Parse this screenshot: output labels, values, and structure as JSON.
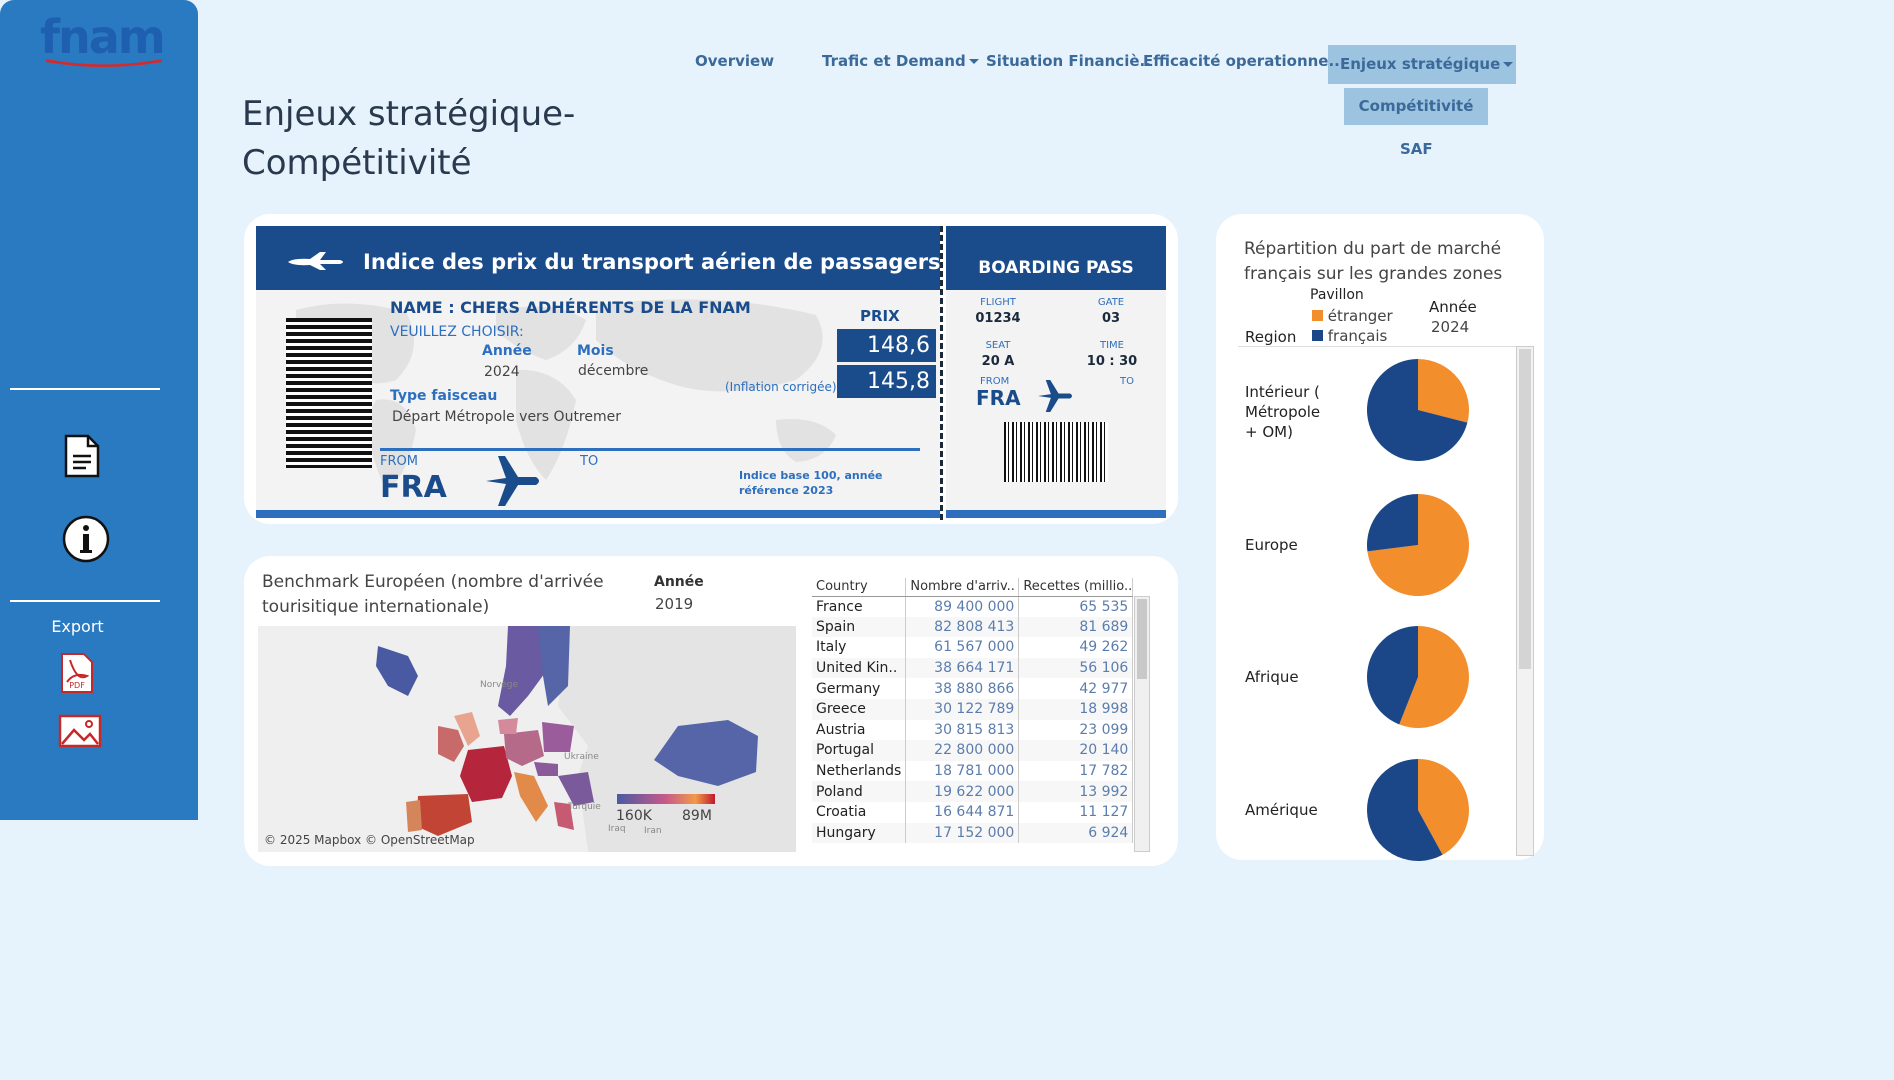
{
  "logo": {
    "text": "fnam"
  },
  "nav": {
    "overview": "Overview",
    "trafic": "Trafic et Demand",
    "situation": "Situation Financiè..",
    "efficacite": "Efficacité operationne..",
    "enjeux": "Enjeux stratégique",
    "sub_competitivite": "Compétitivité",
    "sub_saf": "SAF"
  },
  "page_title": "Enjeux stratégique-Compétitivité",
  "sidebar": {
    "export_label": "Export",
    "icons": [
      "document-icon",
      "info-icon",
      "pdf-icon",
      "image-icon"
    ],
    "pdf_text": "PDF"
  },
  "ticket": {
    "title": "Indice des prix du transport aérien de passagers",
    "name_line": "NAME : CHERS ADHÉRENTS DE LA FNAM",
    "choose": "VEUILLEZ CHOISIR:",
    "annee_label": "Année",
    "annee_value": "2024",
    "mois_label": "Mois",
    "mois_value": "décembre",
    "type_label": "Type faisceau",
    "type_value": "Départ Métropole vers Outremer",
    "prix_label": "PRIX",
    "prix_value": "148,6",
    "prix_corr_value": "145,8",
    "inflation_label": "(Inflation corrigée)",
    "from_label": "FROM",
    "to_label": "TO",
    "from_code": "FRA",
    "base_note": "Indice base 100, année référence 2023"
  },
  "boarding": {
    "title": "BOARDING PASS",
    "flight_label": "FLIGHT",
    "flight_value": "01234",
    "gate_label": "GATE",
    "gate_value": "03",
    "seat_label": "SEAT",
    "seat_value": "20 A",
    "time_label": "TIME",
    "time_value": "10 : 30",
    "from_label": "FROM",
    "to_label": "TO",
    "from_code": "FRA"
  },
  "benchmark": {
    "title": "Benchmark Européen (nombre d'arrivée tourisitique internationale)",
    "annee_label": "Année",
    "annee_value": "2019",
    "legend_min": "160K",
    "legend_max": "89M",
    "map_attribution": "© 2025 Mapbox © OpenStreetMap",
    "map_labels": {
      "norway": "Norvège",
      "ukraine": "Ukraine",
      "turkey": "Turquie",
      "iraq": "Iraq",
      "iran": "Iran"
    },
    "columns": [
      "Country",
      "Nombre d'arriv..",
      "Recettes (millio.."
    ],
    "rows": [
      [
        "France",
        "89 400 000",
        "65 535"
      ],
      [
        "Spain",
        "82 808 413",
        "81 689"
      ],
      [
        "Italy",
        "61 567 000",
        "49 262"
      ],
      [
        "United Kin..",
        "38 664 171",
        "56 106"
      ],
      [
        "Germany",
        "38 880 866",
        "42 977"
      ],
      [
        "Greece",
        "30 122 789",
        "18 998"
      ],
      [
        "Austria",
        "30 815 813",
        "23 099"
      ],
      [
        "Portugal",
        "22 800 000",
        "20 140"
      ],
      [
        "Netherlands",
        "18 781 000",
        "17 782"
      ],
      [
        "Poland",
        "19 622 000",
        "13 992"
      ],
      [
        "Croatia",
        "16 644 871",
        "11 127"
      ],
      [
        "Hungary",
        "17 152 000",
        "6 924"
      ]
    ]
  },
  "market": {
    "title": "Répartition du part de marché français sur les grandes zones",
    "pavillon_label": "Pavillon",
    "legend": [
      {
        "name": "étranger",
        "color": "#f28e2b"
      },
      {
        "name": "français",
        "color": "#1b4788"
      }
    ],
    "annee_label": "Année",
    "annee_value": "2024",
    "region_header": "Region"
  },
  "chart_data": {
    "type": "pie",
    "title": "Répartition du part de marché français sur les grandes zones",
    "legend_title": "Pavillon",
    "series_names": [
      "étranger",
      "français"
    ],
    "colors": {
      "étranger": "#f28e2b",
      "français": "#1b4788"
    },
    "pies": [
      {
        "region": "Intérieur ( Métropole + OM)",
        "etranger": 0.29,
        "francais": 0.71
      },
      {
        "region": "Europe",
        "etranger": 0.73,
        "francais": 0.27
      },
      {
        "region": "Afrique",
        "etranger": 0.56,
        "francais": 0.44
      },
      {
        "region": "Amérique",
        "etranger": 0.42,
        "francais": 0.58
      }
    ]
  }
}
